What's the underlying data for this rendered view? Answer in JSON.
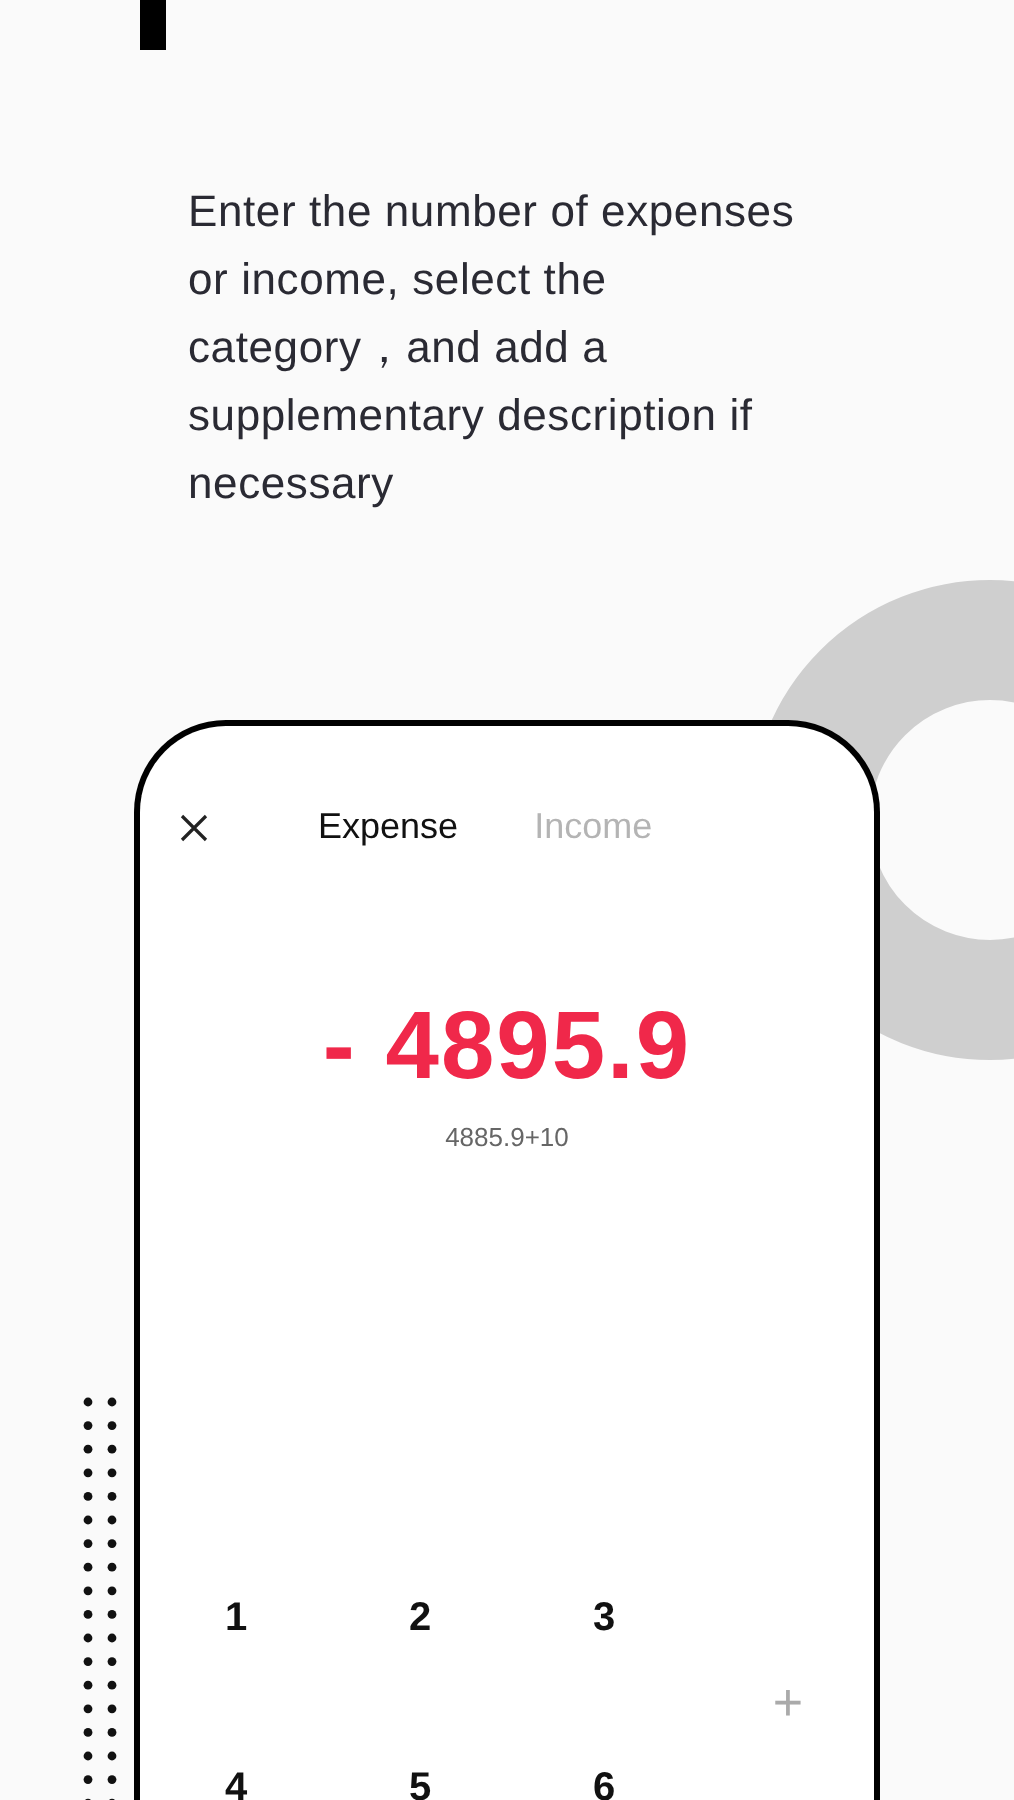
{
  "headline": "Enter the number of expenses or income, select the category，and add a supplementary description if necessary",
  "tabs": [
    {
      "label": "Expense",
      "selected": true
    },
    {
      "label": "Income",
      "selected": false
    }
  ],
  "amount": "- 4895.9",
  "expression": "4885.9+10",
  "keypad": [
    {
      "label": "1",
      "kind": "digit"
    },
    {
      "label": "2",
      "kind": "digit"
    },
    {
      "label": "3",
      "kind": "digit"
    },
    {
      "label": "+",
      "kind": "operator"
    },
    {
      "label": "4",
      "kind": "digit"
    },
    {
      "label": "5",
      "kind": "digit"
    },
    {
      "label": "6",
      "kind": "digit"
    }
  ]
}
